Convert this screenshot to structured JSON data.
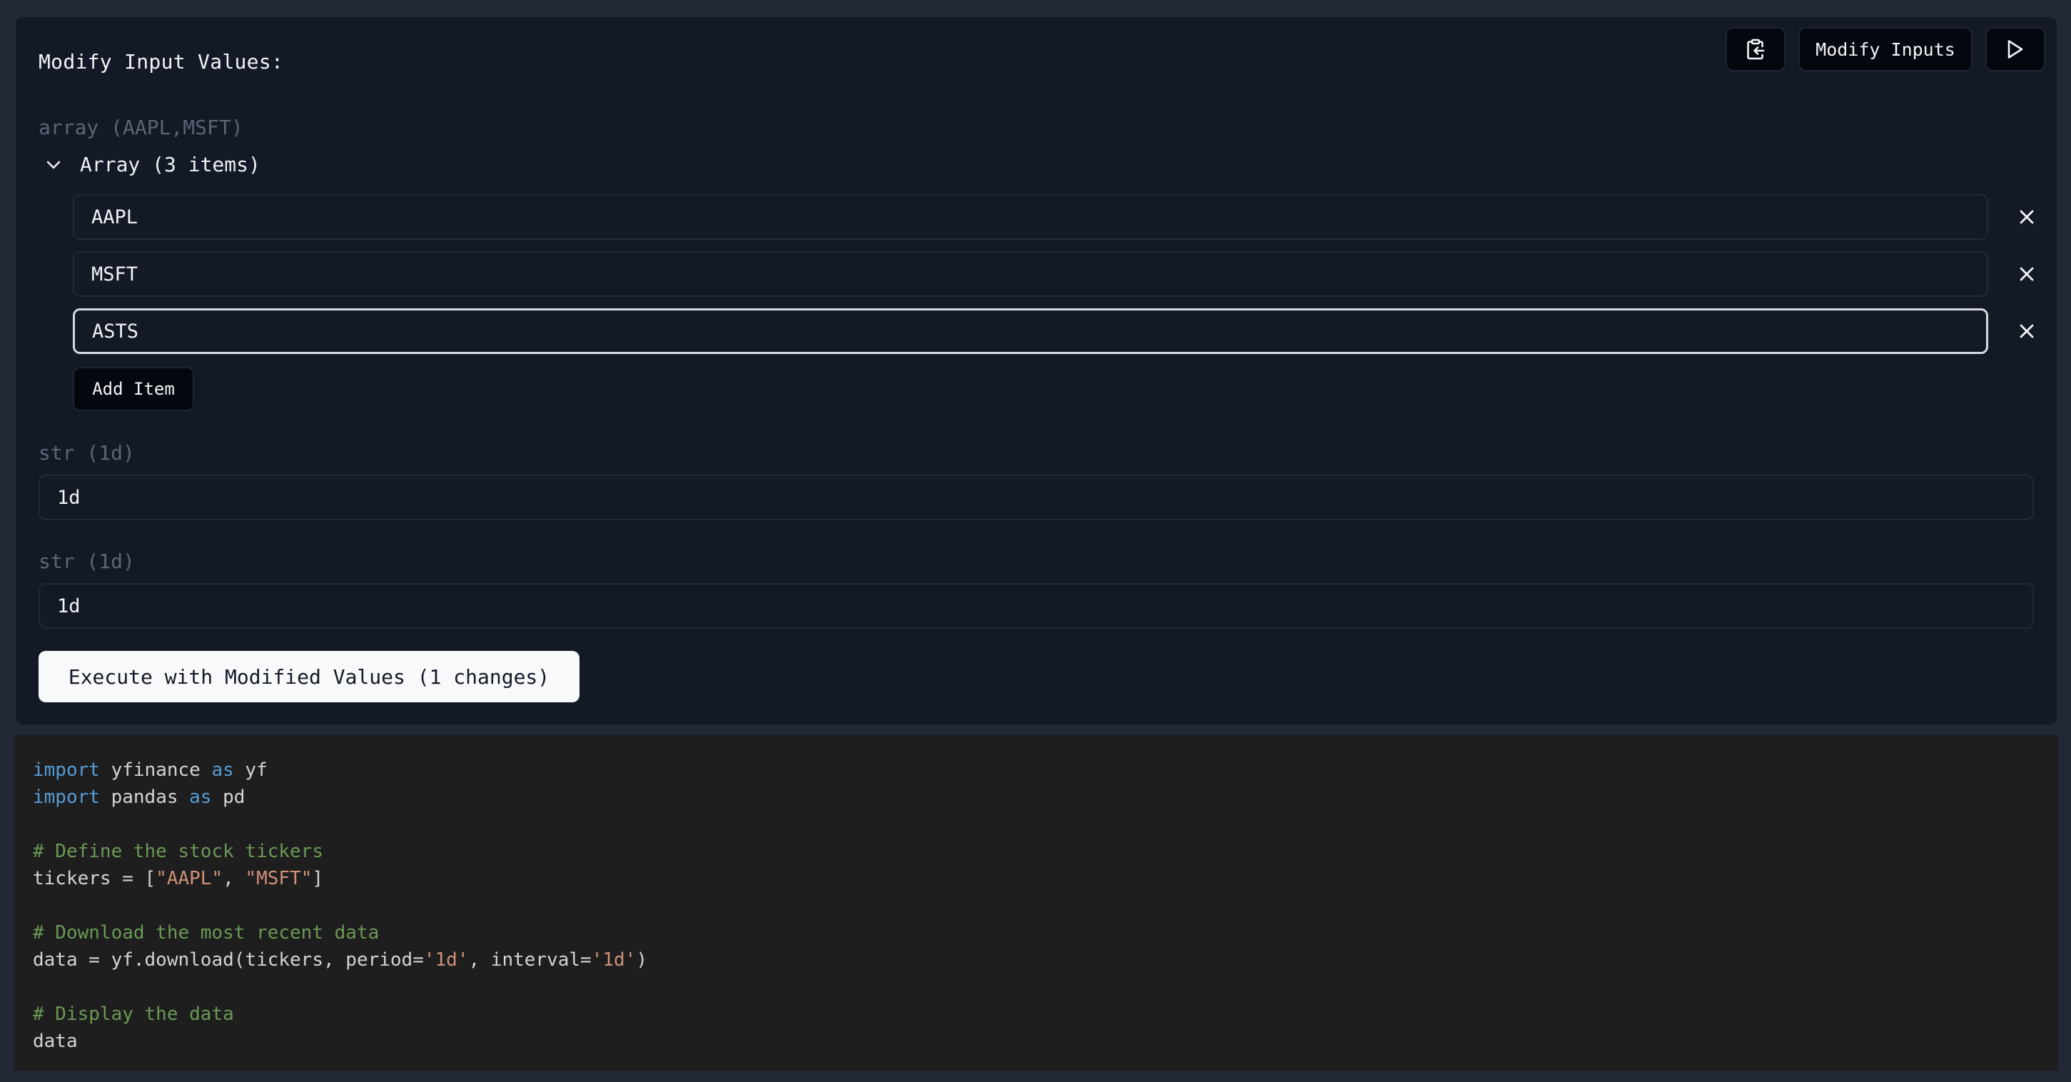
{
  "panel": {
    "title": "Modify Input Values:",
    "top_actions": {
      "paste_icon": "clipboard-paste-icon",
      "modify_inputs_label": "Modify Inputs",
      "run_icon": "play-icon"
    },
    "array_field": {
      "label": "array (AAPL,MSFT)",
      "toggle_label": "Array (3 items)",
      "toggle_icon": "chevron-down-icon",
      "items": [
        {
          "value": "AAPL"
        },
        {
          "value": "MSFT"
        },
        {
          "value": "ASTS"
        }
      ],
      "remove_icon": "close-icon",
      "add_item_label": "Add Item"
    },
    "str_fields": [
      {
        "label": "str (1d)",
        "value": "1d"
      },
      {
        "label": "str (1d)",
        "value": "1d"
      }
    ],
    "execute_label": "Execute with Modified Values (1 changes)"
  },
  "code": {
    "language": "python",
    "lines": [
      [
        {
          "t": "import",
          "c": "kw"
        },
        {
          "t": " yfinance ",
          "c": ""
        },
        {
          "t": "as",
          "c": "kw"
        },
        {
          "t": " yf",
          "c": ""
        }
      ],
      [
        {
          "t": "import",
          "c": "kw"
        },
        {
          "t": " pandas ",
          "c": ""
        },
        {
          "t": "as",
          "c": "kw"
        },
        {
          "t": " pd",
          "c": ""
        }
      ],
      [],
      [
        {
          "t": "# Define the stock tickers",
          "c": "cm"
        }
      ],
      [
        {
          "t": "tickers = [",
          "c": ""
        },
        {
          "t": "\"AAPL\"",
          "c": "st"
        },
        {
          "t": ", ",
          "c": ""
        },
        {
          "t": "\"MSFT\"",
          "c": "st"
        },
        {
          "t": "]",
          "c": ""
        }
      ],
      [],
      [
        {
          "t": "# Download the most recent data",
          "c": "cm"
        }
      ],
      [
        {
          "t": "data = yf.download(tickers, period=",
          "c": ""
        },
        {
          "t": "'1d'",
          "c": "st"
        },
        {
          "t": ", interval=",
          "c": ""
        },
        {
          "t": "'1d'",
          "c": "st"
        },
        {
          "t": ")",
          "c": ""
        }
      ],
      [],
      [
        {
          "t": "# Display the data",
          "c": "cm"
        }
      ],
      [
        {
          "t": "data",
          "c": ""
        }
      ]
    ]
  },
  "colors": {
    "background": "#222836",
    "panel": "#131925",
    "code_bg": "#1e1e1e",
    "keyword": "#569cd6",
    "comment": "#6a9955",
    "string": "#ce9178"
  }
}
